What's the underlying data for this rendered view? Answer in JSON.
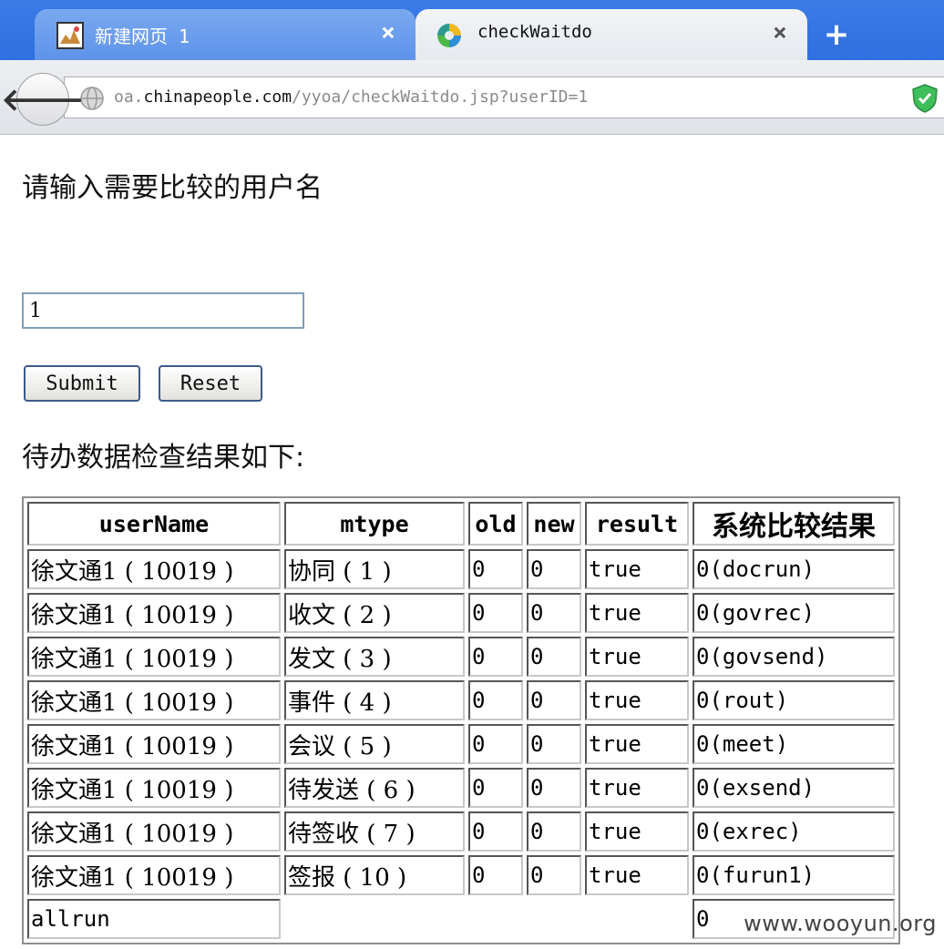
{
  "browser": {
    "tabs": [
      {
        "title": "新建网页 1",
        "active": false
      },
      {
        "title": "checkWaitdo",
        "active": true
      }
    ],
    "url": {
      "prefix": "oa.",
      "host": "chinapeople.com",
      "path": "/yyoa/checkWaitdo.jsp?userID=1"
    }
  },
  "page": {
    "prompt": "请输入需要比较的用户名",
    "username_value": "1",
    "submit_label": "Submit",
    "reset_label": "Reset",
    "result_heading": "待办数据检查结果如下:",
    "table": {
      "headers": [
        "userName",
        "mtype",
        "old",
        "new",
        "result",
        "系统比较结果"
      ],
      "rows": [
        [
          "徐文通1 ( 10019 )",
          "协同 ( 1 )",
          "0",
          "0",
          "true",
          "0(docrun)"
        ],
        [
          "徐文通1 ( 10019 )",
          "收文 ( 2 )",
          "0",
          "0",
          "true",
          "0(govrec)"
        ],
        [
          "徐文通1 ( 10019 )",
          "发文 ( 3 )",
          "0",
          "0",
          "true",
          "0(govsend)"
        ],
        [
          "徐文通1 ( 10019 )",
          "事件 ( 4 )",
          "0",
          "0",
          "true",
          "0(rout)"
        ],
        [
          "徐文通1 ( 10019 )",
          "会议 ( 5 )",
          "0",
          "0",
          "true",
          "0(meet)"
        ],
        [
          "徐文通1 ( 10019 )",
          "待发送 ( 6 )",
          "0",
          "0",
          "true",
          "0(exsend)"
        ],
        [
          "徐文通1 ( 10019 )",
          "待签收 ( 7 )",
          "0",
          "0",
          "true",
          "0(exrec)"
        ],
        [
          "徐文通1 ( 10019 )",
          "签报 ( 10 )",
          "0",
          "0",
          "true",
          "0(furun1)"
        ]
      ],
      "footer": {
        "label": "allrun",
        "value": "0"
      }
    }
  },
  "watermark": "www.wooyun.org",
  "colors": {
    "tabstrip": "#2f6fdf",
    "input_border": "#7f9db9",
    "button_border": "#3c5a8a"
  }
}
